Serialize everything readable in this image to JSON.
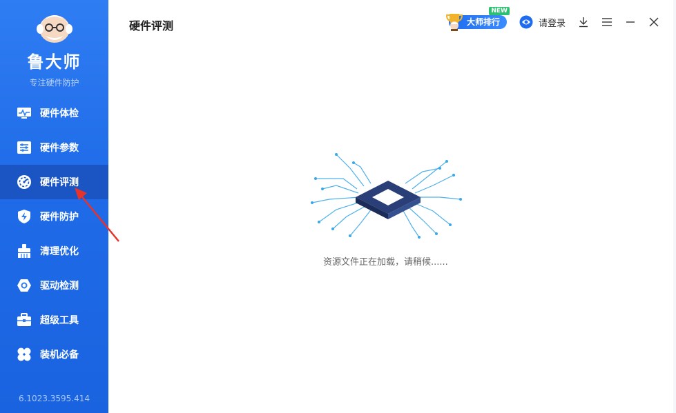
{
  "brand": {
    "name": "鲁大师",
    "slogan": "专注硬件防护"
  },
  "sidebar": {
    "items": [
      {
        "label": "硬件体检",
        "icon": "monitor-wave-icon",
        "active": false
      },
      {
        "label": "硬件参数",
        "icon": "sliders-icon",
        "active": false
      },
      {
        "label": "硬件评测",
        "icon": "speedometer-icon",
        "active": true
      },
      {
        "label": "硬件防护",
        "icon": "shield-bolt-icon",
        "active": false
      },
      {
        "label": "清理优化",
        "icon": "brush-icon",
        "active": false
      },
      {
        "label": "驱动检测",
        "icon": "hex-gear-icon",
        "active": false
      },
      {
        "label": "超级工具",
        "icon": "toolbox-icon",
        "active": false
      },
      {
        "label": "装机必备",
        "icon": "clover-icon",
        "active": false
      }
    ],
    "version": "6.1023.3595.414"
  },
  "header": {
    "title": "硬件评测",
    "rank_label": "大师排行",
    "new_tag": "NEW",
    "login_label": "请登录"
  },
  "main": {
    "loading_text": "资源文件正在加载，请稍候......"
  },
  "colors": {
    "sidebar": "#1f6be8",
    "active": "#1b55c4",
    "accent": "#1e6cf0",
    "arrow": "#e8332a"
  }
}
